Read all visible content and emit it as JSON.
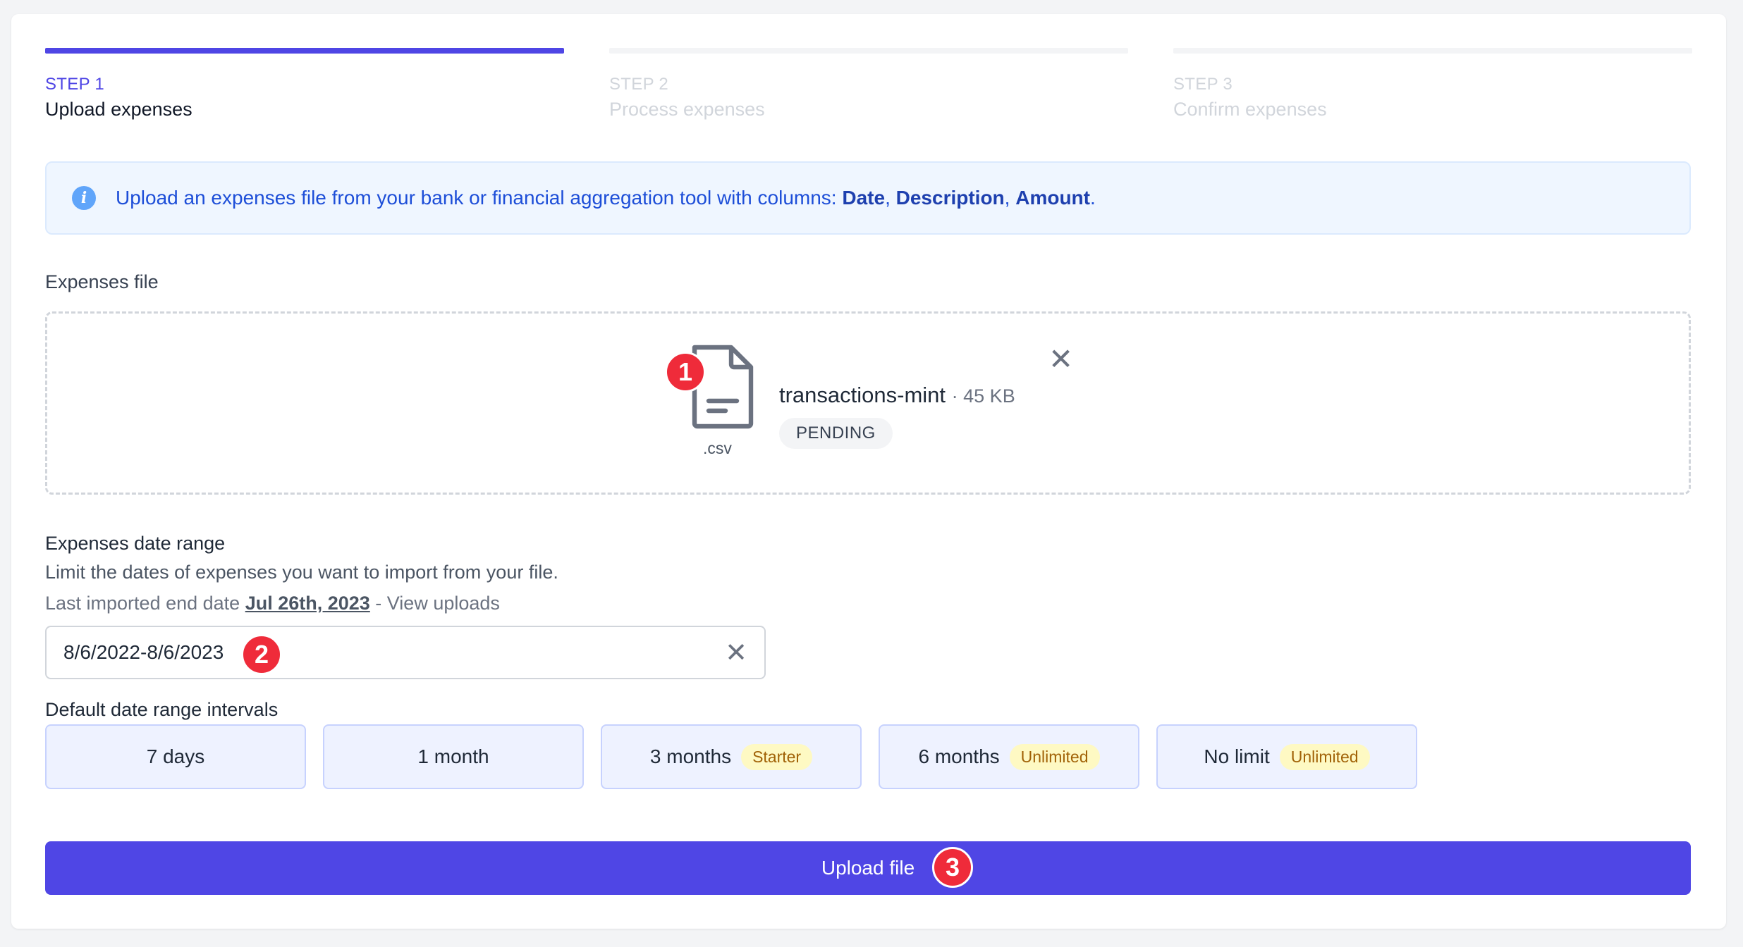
{
  "steps": [
    {
      "num": "STEP 1",
      "name": "Upload expenses"
    },
    {
      "num": "STEP 2",
      "name": "Process expenses"
    },
    {
      "num": "STEP 3",
      "name": "Confirm expenses"
    }
  ],
  "info": {
    "text": "Upload an expenses file from your bank or financial aggregation tool with columns: ",
    "col1": "Date",
    "col2": "Description",
    "col3": "Amount",
    "sep": ", ",
    "end": "."
  },
  "expenses_file": {
    "label": "Expenses file",
    "file_name": "transactions-mint",
    "file_size": "· 45 KB",
    "status": "PENDING",
    "extension": ".csv"
  },
  "date_range": {
    "label": "Expenses date range",
    "description": "Limit the dates of expenses you want to import from your file.",
    "last_imported_prefix": "Last imported end date ",
    "last_imported_date": "Jul 26th, 2023",
    "view_uploads": " - View uploads",
    "value": "8/6/2022-8/6/2023"
  },
  "intervals": {
    "label": "Default date range intervals",
    "items": [
      {
        "label": "7 days",
        "tier": ""
      },
      {
        "label": "1 month",
        "tier": ""
      },
      {
        "label": "3 months",
        "tier": "Starter"
      },
      {
        "label": "6 months",
        "tier": "Unlimited"
      },
      {
        "label": "No limit",
        "tier": "Unlimited"
      }
    ]
  },
  "upload_button": "Upload file",
  "annotations": [
    "1",
    "2",
    "3"
  ],
  "colors": {
    "accent": "#4f46e5",
    "badge": "#ef2b3a",
    "info_bg": "#eff6ff",
    "tier_bg": "#fef9c3"
  }
}
